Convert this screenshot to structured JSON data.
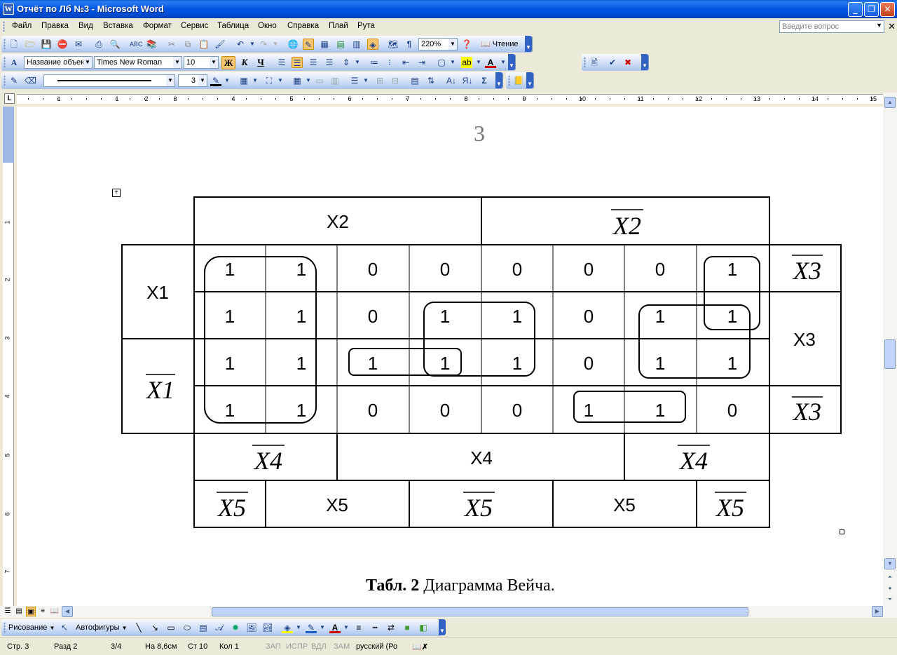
{
  "window": {
    "title": "Отчёт по Лб №3 - Microsoft Word"
  },
  "menu": {
    "items": [
      "Файл",
      "Правка",
      "Вид",
      "Вставка",
      "Формат",
      "Сервис",
      "Таблица",
      "Окно",
      "Справка",
      "Плай",
      "Рута"
    ],
    "ask_placeholder": "Введите вопрос"
  },
  "toolbar": {
    "zoom": "220%",
    "reading_label": "Чтение",
    "style": "Название объек",
    "font": "Times New Roman",
    "font_size": "10",
    "bold_label": "Ж",
    "italic_label": "К",
    "underline_label": "Ч",
    "line_weight": "3"
  },
  "ruler": {
    "tab_marker": "L",
    "numbers": [
      "1",
      "1",
      "2",
      "3",
      "4",
      "5",
      "6",
      "7",
      "8",
      "9",
      "10",
      "11",
      "12",
      "13",
      "14",
      "15"
    ],
    "vertical_numbers": [
      "1",
      "1",
      "2",
      "1",
      "3",
      "1",
      "4",
      "5",
      "6",
      "7"
    ]
  },
  "document": {
    "page_number": "3",
    "veitch": {
      "header_top": {
        "x2": "X2",
        "x2_bar": "X2"
      },
      "row_vars": {
        "x1": "X1",
        "x1_bar": "X1",
        "x3_bar_top": "X3",
        "x3": "X3",
        "x3_bar_bottom": "X3"
      },
      "x4_row": {
        "x4_bar_left": "X4",
        "x4": "X4",
        "x4_bar_right": "X4"
      },
      "x5_row": {
        "x5_bar_1": "X5",
        "x5_1": "X5",
        "x5_bar_2": "X5",
        "x5_2": "X5",
        "x5_bar_3": "X5"
      },
      "cells": [
        [
          "1",
          "1",
          "0",
          "0",
          "0",
          "0",
          "0",
          "1"
        ],
        [
          "1",
          "1",
          "0",
          "1",
          "1",
          "0",
          "1",
          "1"
        ],
        [
          "1",
          "1",
          "1",
          "1",
          "1",
          "0",
          "1",
          "1"
        ],
        [
          "1",
          "1",
          "0",
          "0",
          "0",
          "1",
          "1",
          "0"
        ]
      ]
    },
    "caption": {
      "bold": "Табл. 2",
      "rest": " Диаграмма Вейча."
    }
  },
  "drawing_toolbar": {
    "draw_label": "Рисование",
    "autoshapes_label": "Автофигуры"
  },
  "status": {
    "page": "Стр. 3",
    "section": "Разд 2",
    "pages": "3/4",
    "position": "На 8,6см",
    "line": "Ст 10",
    "column": "Кол 1",
    "rec": "ЗАП",
    "trk": "ИСПР",
    "ext": "ВДЛ",
    "ovr": "ЗАМ",
    "language": "русский (Ро"
  }
}
